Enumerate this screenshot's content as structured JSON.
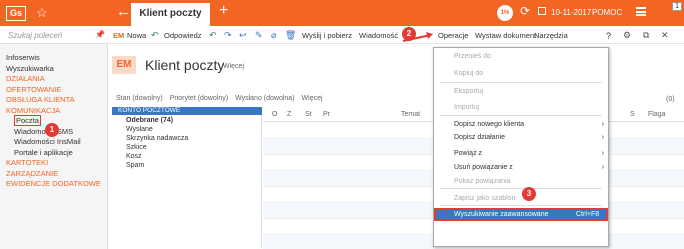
{
  "topbar": {
    "logo": "Gs",
    "tab_title": "Klient poczty",
    "percent_label": "1%",
    "date": "10-11-2017",
    "help": "POMOC",
    "corner_marker": "1"
  },
  "sidebar": {
    "search_placeholder": "Szukaj poleceń",
    "items": [
      {
        "label": "Infoserwis",
        "type": "link"
      },
      {
        "label": "Wyszukiwarka",
        "type": "link"
      },
      {
        "label": "DZIAŁANIA",
        "type": "head"
      },
      {
        "label": "OFERTOWANIE",
        "type": "head"
      },
      {
        "label": "OBSŁUGA KLIENTA",
        "type": "head"
      },
      {
        "label": "KOMUNIKACJA",
        "type": "head"
      },
      {
        "label": "Poczta",
        "type": "sub-selected"
      },
      {
        "label": "Wiadomości SMS",
        "type": "sub"
      },
      {
        "label": "Wiadomości InsMail",
        "type": "sub"
      },
      {
        "label": "Portale i aplikacje",
        "type": "sub"
      },
      {
        "label": "KARTOTEKI",
        "type": "head"
      },
      {
        "label": "ZARZĄDZANIE",
        "type": "head"
      },
      {
        "label": "EWIDENCJE DODATKOWE",
        "type": "head"
      }
    ]
  },
  "toolbar": {
    "em": "EM",
    "nowa": "Nowa",
    "odpowiedz": "Odpowiedz",
    "wyslij_pobierz": "Wyślij i pobierz",
    "wiadomosc": "Wiadomość",
    "operacje": "Operacje",
    "wystaw_dokument": "Wystaw dokument",
    "narzedzia": "Narzędzia",
    "question": "?"
  },
  "title": {
    "badge": "EM",
    "text": "Klient poczty",
    "more": "Więcej"
  },
  "filters": [
    "Stan (dowolny)",
    "Priorytet (dowolny)",
    "Wysłano (dowolna)",
    "Więcej"
  ],
  "count_label": "(0)",
  "tree": {
    "header": "KONTO POCZTOWE",
    "items": [
      "Odebrane (74)",
      "Wysłane",
      "Skrzynka nadawcza",
      "Szkice",
      "Kosz",
      "Spam"
    ]
  },
  "grid_columns": [
    "O",
    "Z",
    "St",
    "Pr",
    "Temat",
    "S",
    "Flaga"
  ],
  "dropdown": {
    "items": [
      {
        "label": "Przenieś do",
        "disabled": true
      },
      {
        "label": "Kopiuj do",
        "disabled": true
      },
      {
        "label": "Eksportuj",
        "disabled": true
      },
      {
        "label": "Importuj",
        "disabled": true
      },
      {
        "label": "Dopisz nowego klienta",
        "submenu": true
      },
      {
        "label": "Dopisz działanie",
        "submenu": true
      },
      {
        "label": "Powiąż z",
        "submenu": true
      },
      {
        "label": "Usuń powiązanie z",
        "submenu": true
      },
      {
        "label": "Pokaż powiązania",
        "disabled": true
      },
      {
        "label": "Zapisz jako szablon",
        "disabled": true
      },
      {
        "label": "Wyszukiwanie zaawansowane",
        "shortcut": "Ctrl+F8",
        "highlighted": true
      }
    ]
  },
  "callouts": [
    "1",
    "2",
    "3"
  ]
}
